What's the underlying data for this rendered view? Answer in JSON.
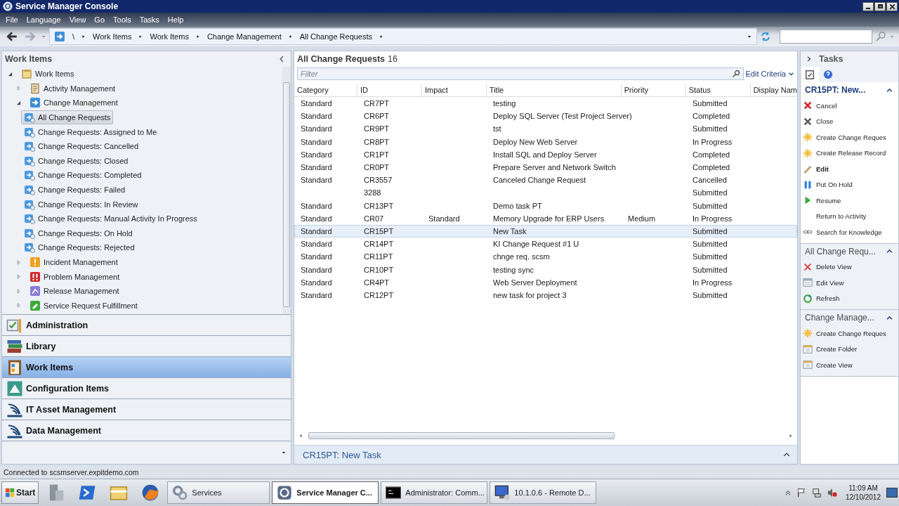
{
  "window": {
    "title": "Service Manager Console"
  },
  "menu": [
    "File",
    "Language",
    "View",
    "Go",
    "Tools",
    "Tasks",
    "Help"
  ],
  "address_bar": {
    "path": [
      "\\",
      "Work Items",
      "Work Items",
      "Change Management",
      "All Change Requests"
    ]
  },
  "navigation_pane": {
    "title": "Work Items",
    "tree": [
      {
        "label": "Work Items",
        "kind": "folder",
        "expanded": true,
        "selected": false,
        "children": [
          {
            "label": "Activity Management",
            "kind": "activity",
            "expanded": false,
            "selected": false
          },
          {
            "label": "Change Management",
            "kind": "change",
            "expanded": true,
            "selected": false,
            "children": [
              {
                "label": "All Change Requests",
                "kind": "view",
                "selected": true
              },
              {
                "label": "Change Requests: Assigned to Me",
                "kind": "view",
                "selected": false
              },
              {
                "label": "Change Requests: Cancelled",
                "kind": "view",
                "selected": false
              },
              {
                "label": "Change Requests: Closed",
                "kind": "view",
                "selected": false
              },
              {
                "label": "Change Requests: Completed",
                "kind": "view",
                "selected": false
              },
              {
                "label": "Change Requests: Failed",
                "kind": "view",
                "selected": false
              },
              {
                "label": "Change Requests: In Review",
                "kind": "view",
                "selected": false
              },
              {
                "label": "Change Requests: Manual Activity In Progress",
                "kind": "view",
                "selected": false
              },
              {
                "label": "Change Requests: On Hold",
                "kind": "view",
                "selected": false
              },
              {
                "label": "Change Requests: Rejected",
                "kind": "view",
                "selected": false
              }
            ]
          },
          {
            "label": "Incident Management",
            "kind": "incident",
            "expanded": false,
            "selected": false
          },
          {
            "label": "Problem Management",
            "kind": "problem",
            "expanded": false,
            "selected": false
          },
          {
            "label": "Release Management",
            "kind": "release",
            "expanded": false,
            "selected": false
          },
          {
            "label": "Service Request Fulfillment",
            "kind": "service",
            "expanded": false,
            "selected": false
          }
        ]
      }
    ],
    "sections": [
      {
        "label": "Administration",
        "kind": "admin",
        "selected": false
      },
      {
        "label": "Library",
        "kind": "library",
        "selected": false
      },
      {
        "label": "Work Items",
        "kind": "workitems",
        "selected": true
      },
      {
        "label": "Configuration Items",
        "kind": "config",
        "selected": false
      },
      {
        "label": "IT Asset Management",
        "kind": "asset",
        "selected": false
      },
      {
        "label": "Data Management",
        "kind": "asset",
        "selected": false
      }
    ]
  },
  "view": {
    "title": "All Change Requests",
    "count": "16",
    "filter": {
      "placeholder": "Filter"
    },
    "edit_criteria": "Edit Criteria",
    "table": {
      "columns": [
        "Category",
        "ID",
        "Impact",
        "Title",
        "Priority",
        "Status",
        "Display Nam"
      ],
      "rows": [
        {
          "cells": [
            "Standard",
            "CR7PT",
            null,
            "testing",
            null,
            "Submitted",
            null
          ],
          "selected": false
        },
        {
          "cells": [
            "Standard",
            "CR6PT",
            null,
            "Deploy SQL Server (Test Project Server)",
            null,
            "Completed",
            null
          ],
          "selected": false
        },
        {
          "cells": [
            "Standard",
            "CR9PT",
            null,
            "tst",
            null,
            "Submitted",
            null
          ],
          "selected": false
        },
        {
          "cells": [
            "Standard",
            "CR8PT",
            null,
            "Deploy New Web Server",
            null,
            "In Progress",
            null
          ],
          "selected": false
        },
        {
          "cells": [
            "Standard",
            "CR1PT",
            null,
            "Install SQL and Deploy Server",
            null,
            "Completed",
            null
          ],
          "selected": false
        },
        {
          "cells": [
            "Standard",
            "CR0PT",
            null,
            "Prepare Server and Network Switch",
            null,
            "Completed",
            null
          ],
          "selected": false
        },
        {
          "cells": [
            "Standard",
            "CR3557",
            null,
            "Canceled Change Request",
            null,
            "Cancelled",
            null
          ],
          "selected": false
        },
        {
          "cells": [
            null,
            "3288",
            null,
            null,
            null,
            "Submitted",
            null
          ],
          "selected": false
        },
        {
          "cells": [
            "Standard",
            "CR13PT",
            null,
            "Demo task PT",
            null,
            "Submitted",
            null
          ],
          "selected": false
        },
        {
          "cells": [
            "Standard",
            "CR07",
            "Standard",
            "Memory Upgrade for ERP Users",
            "Medium",
            "In Progress",
            null
          ],
          "selected": false
        },
        {
          "cells": [
            "Standard",
            "CR15PT",
            null,
            "New Task",
            null,
            "Submitted",
            null
          ],
          "selected": true
        },
        {
          "cells": [
            "Standard",
            "CR14PT",
            null,
            "KI Change Request #1 U",
            null,
            "Submitted",
            null
          ],
          "selected": false
        },
        {
          "cells": [
            "Standard",
            "CR11PT",
            null,
            "chnge req. scsm",
            null,
            "Submitted",
            null
          ],
          "selected": false
        },
        {
          "cells": [
            "Standard",
            "CR10PT",
            null,
            "testing sync",
            null,
            "Submitted",
            null
          ],
          "selected": false
        },
        {
          "cells": [
            "Standard",
            "CR4PT",
            null,
            "Web Server Deployment",
            null,
            "In Progress",
            null
          ],
          "selected": false
        },
        {
          "cells": [
            "Standard",
            "CR12PT",
            null,
            "new task for project 3",
            null,
            "Submitted",
            null
          ],
          "selected": false
        }
      ]
    },
    "preview": "CR15PT: New Task"
  },
  "tasks": {
    "title": "Tasks",
    "tabs": [
      {
        "kind": "clipboard",
        "selected": true
      },
      {
        "kind": "help",
        "selected": false
      }
    ],
    "sections": [
      {
        "title": "CR15PT: New...",
        "primary": true,
        "items": [
          {
            "label": "Cancel",
            "kind": "cancel",
            "emphasized": false
          },
          {
            "label": "Close",
            "kind": "close",
            "emphasized": false
          },
          {
            "label": "Create Change Reques",
            "kind": "create",
            "emphasized": false
          },
          {
            "label": "Create Release Record",
            "kind": "create",
            "emphasized": false
          },
          {
            "label": "Edit",
            "kind": "edit",
            "emphasized": true
          },
          {
            "label": "Put On Hold",
            "kind": "hold",
            "emphasized": false
          },
          {
            "label": "Resume",
            "kind": "resume",
            "emphasized": false
          },
          {
            "label": "Return to Activity",
            "kind": "none",
            "emphasized": false
          },
          {
            "label": "Search for Knowledge",
            "kind": "search",
            "emphasized": false
          }
        ]
      },
      {
        "title": "All Change Requ...",
        "primary": false,
        "items": [
          {
            "label": "Delete View",
            "kind": "delete",
            "emphasized": false
          },
          {
            "label": "Edit View",
            "kind": "view",
            "emphasized": false
          },
          {
            "label": "Refresh",
            "kind": "refresh",
            "emphasized": false
          }
        ]
      },
      {
        "title": "Change Manage...",
        "primary": false,
        "items": [
          {
            "label": "Create Change Reques",
            "kind": "create",
            "emphasized": false
          },
          {
            "label": "Create Folder",
            "kind": "folder",
            "emphasized": false
          },
          {
            "label": "Create View",
            "kind": "folder",
            "emphasized": false
          }
        ]
      }
    ]
  },
  "status_bar": "Connected to scsmserver.expitdemo.com",
  "taskbar": {
    "start": "Start",
    "pinned": [
      {
        "kind": "server"
      },
      {
        "kind": "shell"
      },
      {
        "kind": "explorer"
      },
      {
        "kind": "browser"
      }
    ],
    "windows": [
      {
        "label": "Services",
        "kind": "gears",
        "selected": false
      },
      {
        "label": "Service Manager C...",
        "kind": "console",
        "selected": true
      },
      {
        "label": "Administrator: Comm...",
        "kind": "cmd",
        "selected": false
      },
      {
        "label": "10.1.0.6 - Remote D...",
        "kind": "remote",
        "selected": false
      }
    ],
    "clock": {
      "time": "11:09 AM",
      "date": "12/10/2012"
    }
  }
}
